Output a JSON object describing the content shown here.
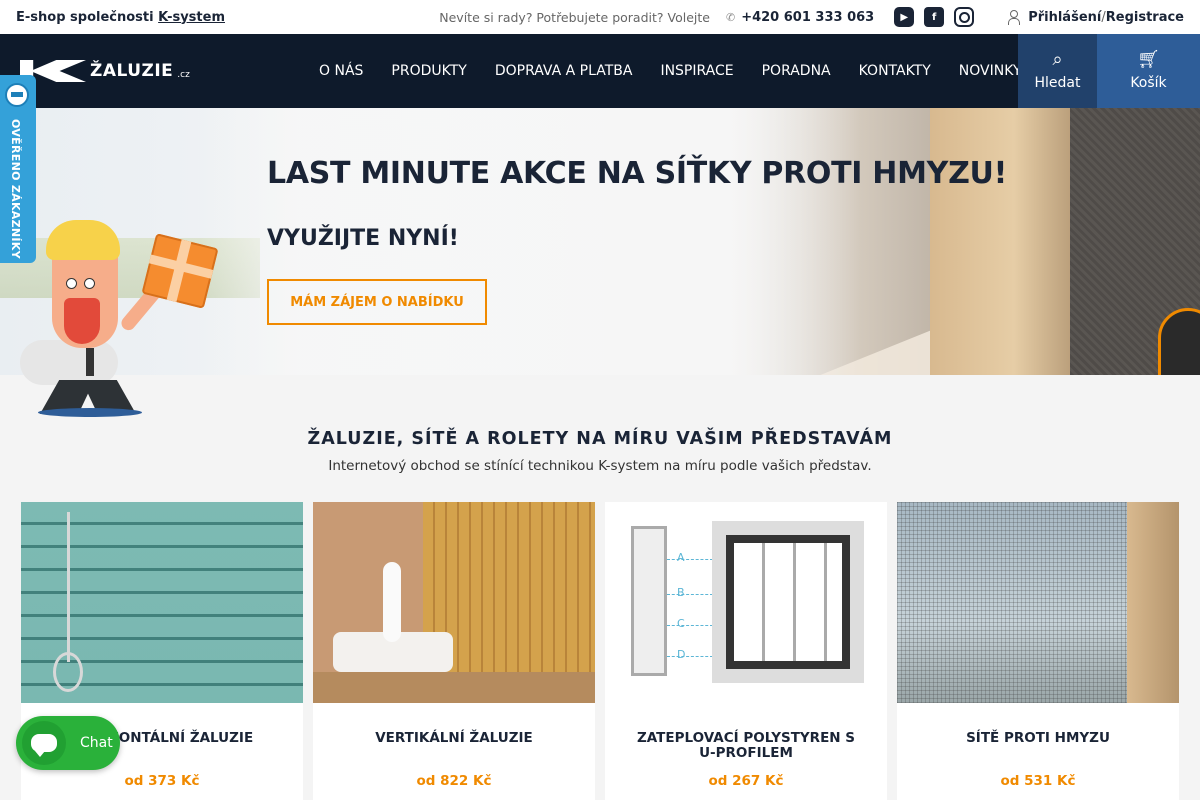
{
  "topbar": {
    "brand_prefix": "E-shop společnosti",
    "brand_link": "K-system",
    "help_text": "Nevíte si rady? Potřebujete poradit? Volejte",
    "phone": "+420 601 333 063",
    "login": "Přihlášení",
    "separator": "/",
    "register": "Registrace"
  },
  "nav": {
    "logo_text": "ŽALUZIE",
    "logo_suffix": ".cz",
    "items": [
      "O NÁS",
      "PRODUKTY",
      "DOPRAVA A PLATBA",
      "INSPIRACE",
      "PORADNA",
      "KONTAKTY",
      "NOVINKY"
    ],
    "search_label": "Hledat",
    "cart_label": "Košík"
  },
  "hero": {
    "title": "LAST MINUTE AKCE NA SÍŤKY PROTI HMYZU!",
    "subtitle": "VYUŽIJTE NYNÍ!",
    "cta": "MÁM ZÁJEM O NABÍDKU"
  },
  "badge": {
    "text": "OVĚŘENO ZÁKAZNÍKY"
  },
  "section": {
    "title": "ŽALUZIE, SÍTĚ A ROLETY NA MÍRU VAŠIM PŘEDSTAVÁM",
    "subtitle": "Internetový obchod se stínící technikou K-system na míru podle vašich představ."
  },
  "products": [
    {
      "name": "HORIZONTÁLNÍ ŽALUZIE",
      "price": "od 373 Kč"
    },
    {
      "name": "VERTIKÁLNÍ ŽALUZIE",
      "price": "od 822 Kč"
    },
    {
      "name": "ZATEPLOVACÍ POLYSTYREN S U-PROFILEM",
      "price": "od 267 Kč"
    },
    {
      "name": "SÍTĚ PROTI HMYZU",
      "price": "od 531 Kč"
    }
  ],
  "diagram_labels": [
    "A",
    "B",
    "C",
    "D"
  ],
  "chat": {
    "label": "Chat"
  },
  "colors": {
    "navy": "#0e1a2b",
    "accent": "#f08a00",
    "cart_blue": "#2e5d98",
    "chat_green": "#2ab13a",
    "badge_blue": "#34a1d9"
  }
}
